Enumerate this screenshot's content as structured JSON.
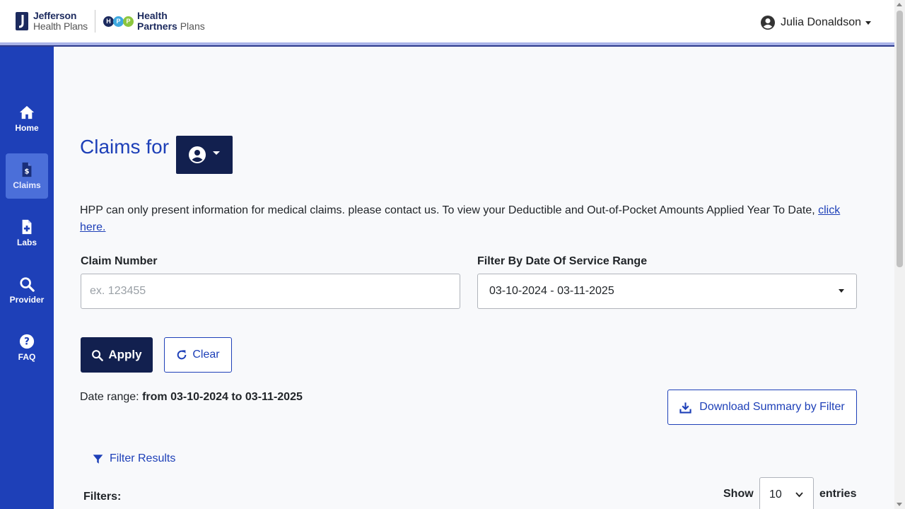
{
  "header": {
    "brand1_line1": "Jefferson",
    "brand1_line2": "Health Plans",
    "brand2_circles": [
      "H",
      "P",
      "P"
    ],
    "brand2_line1": "Health",
    "brand2_line2_bold": "Partners",
    "brand2_line2_light": "Plans",
    "user_name": "Julia Donaldson"
  },
  "sidebar": {
    "items": [
      {
        "label": "Home",
        "icon": "home-icon"
      },
      {
        "label": "Claims",
        "icon": "claim-document-icon",
        "active": true
      },
      {
        "label": "Labs",
        "icon": "lab-document-icon"
      },
      {
        "label": "Provider",
        "icon": "search-icon"
      },
      {
        "label": "FAQ",
        "icon": "question-icon"
      }
    ]
  },
  "main": {
    "title": "Claims for",
    "info_text": "HPP can only present information for medical claims. please contact us. To view your Deductible and Out-of-Pocket Amounts Applied Year To Date, ",
    "info_link": "click here.",
    "claim_number_label": "Claim Number",
    "claim_number_placeholder": "ex. 123455",
    "claim_number_value": "",
    "date_filter_label": "Filter By Date Of Service Range",
    "date_filter_value": "03-10-2024 - 03-11-2025",
    "apply_label": "Apply",
    "clear_label": "Clear",
    "date_range_prefix": "Date range: ",
    "date_range_value": "from 03-10-2024 to 03-11-2025",
    "download_label": "Download Summary by Filter",
    "filter_results_label": "Filter Results",
    "filters_label": "Filters:",
    "show_label": "Show",
    "entries_value": "10",
    "entries_label": "entries"
  },
  "colors": {
    "primary_blue": "#1e40b8",
    "navy": "#12204f",
    "sidebar_active": "#4b6fd9",
    "background": "#f8f9fb"
  }
}
